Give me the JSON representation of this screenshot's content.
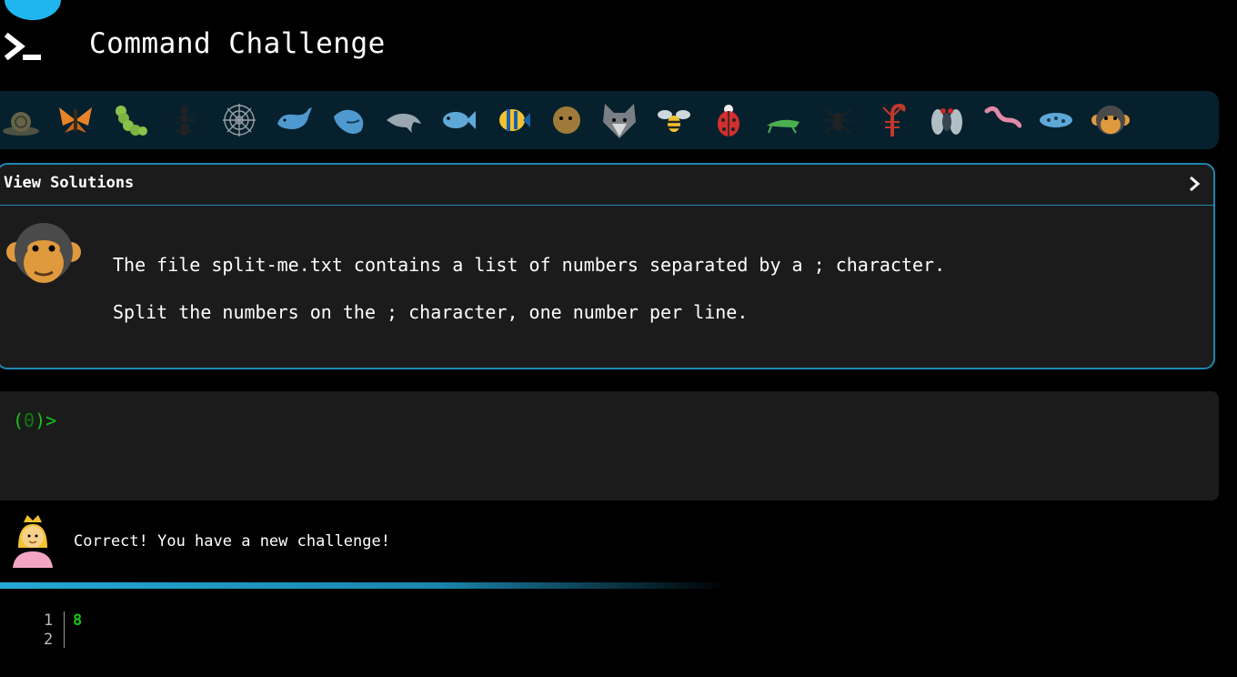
{
  "header": {
    "title": "Command Challenge",
    "logo_icon": "terminal-prompt-icon",
    "accent": "#1fb6f0"
  },
  "animals": [
    {
      "icon": "snail-icon",
      "faded": true
    },
    {
      "icon": "butterfly-icon"
    },
    {
      "icon": "caterpillar-icon"
    },
    {
      "icon": "ant-icon"
    },
    {
      "icon": "spider-web-icon"
    },
    {
      "icon": "whale-icon"
    },
    {
      "icon": "spouting-whale-icon"
    },
    {
      "icon": "dolphin-icon"
    },
    {
      "icon": "fish-icon"
    },
    {
      "icon": "tropical-fish-icon"
    },
    {
      "icon": "blowfish-icon"
    },
    {
      "icon": "wolf-icon"
    },
    {
      "icon": "bee-icon"
    },
    {
      "icon": "ladybug-icon"
    },
    {
      "icon": "cricket-icon"
    },
    {
      "icon": "spider-icon"
    },
    {
      "icon": "scorpion-icon"
    },
    {
      "icon": "fly-icon"
    },
    {
      "icon": "worm-icon"
    },
    {
      "icon": "microbe-icon"
    },
    {
      "icon": "monkey-face-icon"
    }
  ],
  "challenge": {
    "view_solutions_label": "View Solutions",
    "toggle_icon": "chevron-right-icon",
    "avatar_icon": "monkey-face-icon",
    "description_line1": "The file split-me.txt contains a list of numbers separated by a ; character.",
    "description_line2": "Split the numbers on the ; character, one number per line.",
    "border_color": "#1e86b0"
  },
  "terminal": {
    "prompt_open": "(",
    "prompt_count": "0",
    "prompt_close": ")>",
    "prompt_color": "#18c418",
    "input_value": ""
  },
  "feedback": {
    "avatar_icon": "princess-icon",
    "message": "Correct! You have a new challenge!"
  },
  "output": {
    "line_numbers": [
      "1",
      "2"
    ],
    "lines": [
      "8",
      ""
    ]
  }
}
